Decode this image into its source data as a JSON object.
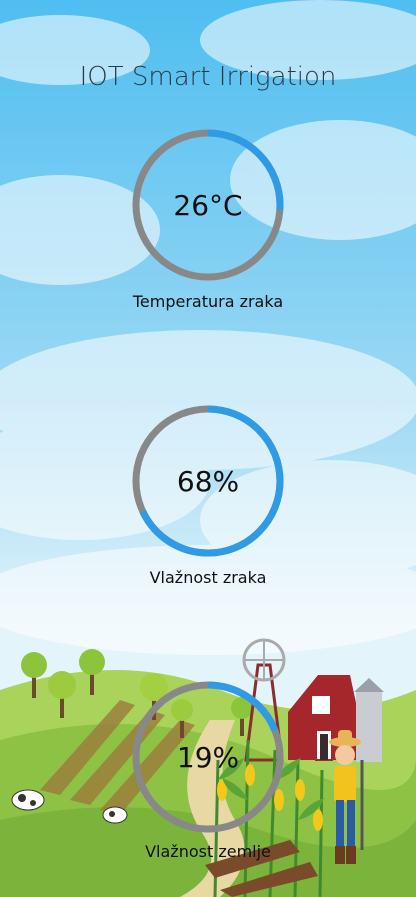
{
  "app": {
    "title": "IOT Smart Irrigation"
  },
  "colors": {
    "ring_track": "#888888",
    "ring_fill": "#2f9ae6",
    "sky_top": "#5cc4f2",
    "sky_bottom": "#d8f1fb"
  },
  "gauges": [
    {
      "value_text": "26°C",
      "label": "Temperatura zraka",
      "fraction": 0.26
    },
    {
      "value_text": "68%",
      "label": "Vlažnost zraka",
      "fraction": 0.68
    },
    {
      "value_text": "19%",
      "label": "Vlažnost zemlje",
      "fraction": 0.19
    }
  ]
}
